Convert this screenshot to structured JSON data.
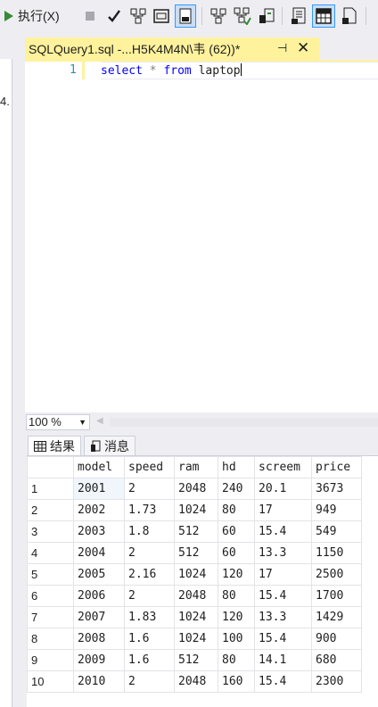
{
  "toolbar": {
    "execute_label": "执行(X)",
    "icons": [
      "execute-icon",
      "stop-icon",
      "parse-check-icon",
      "debug-icon",
      "results-to-text-icon",
      "results-to-file-icon",
      "query-plan-icon",
      "include-plan-icon",
      "client-stats-icon",
      "results-to-grid-icon",
      "results-to-text-2-icon",
      "results-to-file-2-icon"
    ]
  },
  "left_panel": {
    "fragment": "4."
  },
  "tab": {
    "title": "SQLQuery1.sql -...H5K4M4N\\韦 (62))*",
    "pin": "⊣",
    "close": "✕"
  },
  "editor": {
    "line_number": "1",
    "tokens": {
      "kw1": "select",
      "op": "*",
      "kw2": "from",
      "ident": "laptop"
    }
  },
  "status": {
    "zoom": "100 %"
  },
  "results_tabs": {
    "results": "结果",
    "messages": "消息"
  },
  "grid": {
    "columns": [
      "model",
      "speed",
      "ram",
      "hd",
      "screem",
      "price"
    ],
    "rows": [
      {
        "n": "1",
        "model": "2001",
        "speed": "2",
        "ram": "2048",
        "hd": "240",
        "screem": "20.1",
        "price": "3673"
      },
      {
        "n": "2",
        "model": "2002",
        "speed": "1.73",
        "ram": "1024",
        "hd": "80",
        "screem": "17",
        "price": "949"
      },
      {
        "n": "3",
        "model": "2003",
        "speed": "1.8",
        "ram": "512",
        "hd": "60",
        "screem": "15.4",
        "price": "549"
      },
      {
        "n": "4",
        "model": "2004",
        "speed": "2",
        "ram": "512",
        "hd": "60",
        "screem": "13.3",
        "price": "1150"
      },
      {
        "n": "5",
        "model": "2005",
        "speed": "2.16",
        "ram": "1024",
        "hd": "120",
        "screem": "17",
        "price": "2500"
      },
      {
        "n": "6",
        "model": "2006",
        "speed": "2",
        "ram": "2048",
        "hd": "80",
        "screem": "15.4",
        "price": "1700"
      },
      {
        "n": "7",
        "model": "2007",
        "speed": "1.83",
        "ram": "1024",
        "hd": "120",
        "screem": "13.3",
        "price": "1429"
      },
      {
        "n": "8",
        "model": "2008",
        "speed": "1.6",
        "ram": "1024",
        "hd": "100",
        "screem": "15.4",
        "price": "900"
      },
      {
        "n": "9",
        "model": "2009",
        "speed": "1.6",
        "ram": "512",
        "hd": "80",
        "screem": "14.1",
        "price": "680"
      },
      {
        "n": "10",
        "model": "2010",
        "speed": "2",
        "ram": "2048",
        "hd": "160",
        "screem": "15.4",
        "price": "2300"
      }
    ]
  },
  "colors": {
    "accent_tab": "#fff29d",
    "keyword": "#0000ff",
    "line_number": "#2b91af",
    "execute_green": "#388a34"
  }
}
